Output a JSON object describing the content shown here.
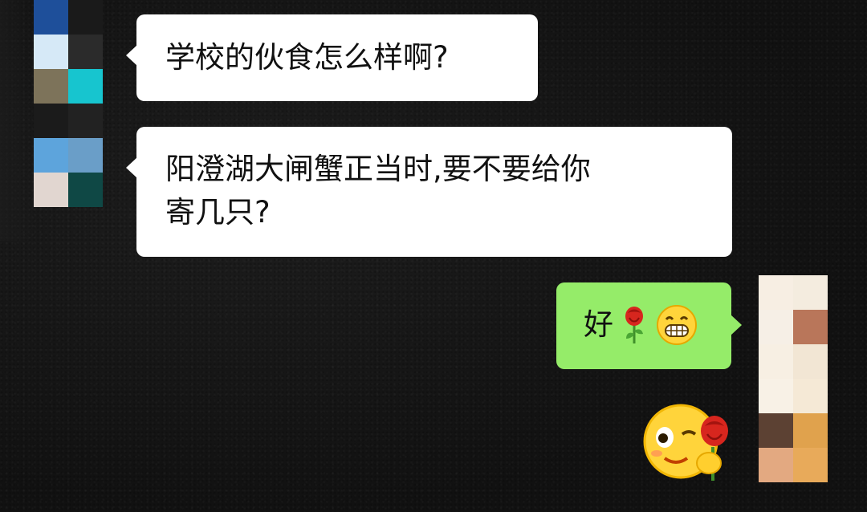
{
  "conversation": {
    "messages": [
      {
        "side": "left",
        "text": "学校的伙食怎么样啊?"
      },
      {
        "side": "left",
        "text": "阳澄湖大闸蟹正当时,要不要给你\n寄几只?"
      },
      {
        "side": "right",
        "text": "好",
        "emojis": [
          "rose-emoji",
          "grin-emoji"
        ]
      },
      {
        "side": "right",
        "sticker": "wink-smiley-with-rose-sticker"
      }
    ]
  },
  "colors": {
    "background": "#141414",
    "incoming_bubble": "#ffffff",
    "outgoing_bubble": "#95ec69",
    "text": "#111111"
  }
}
